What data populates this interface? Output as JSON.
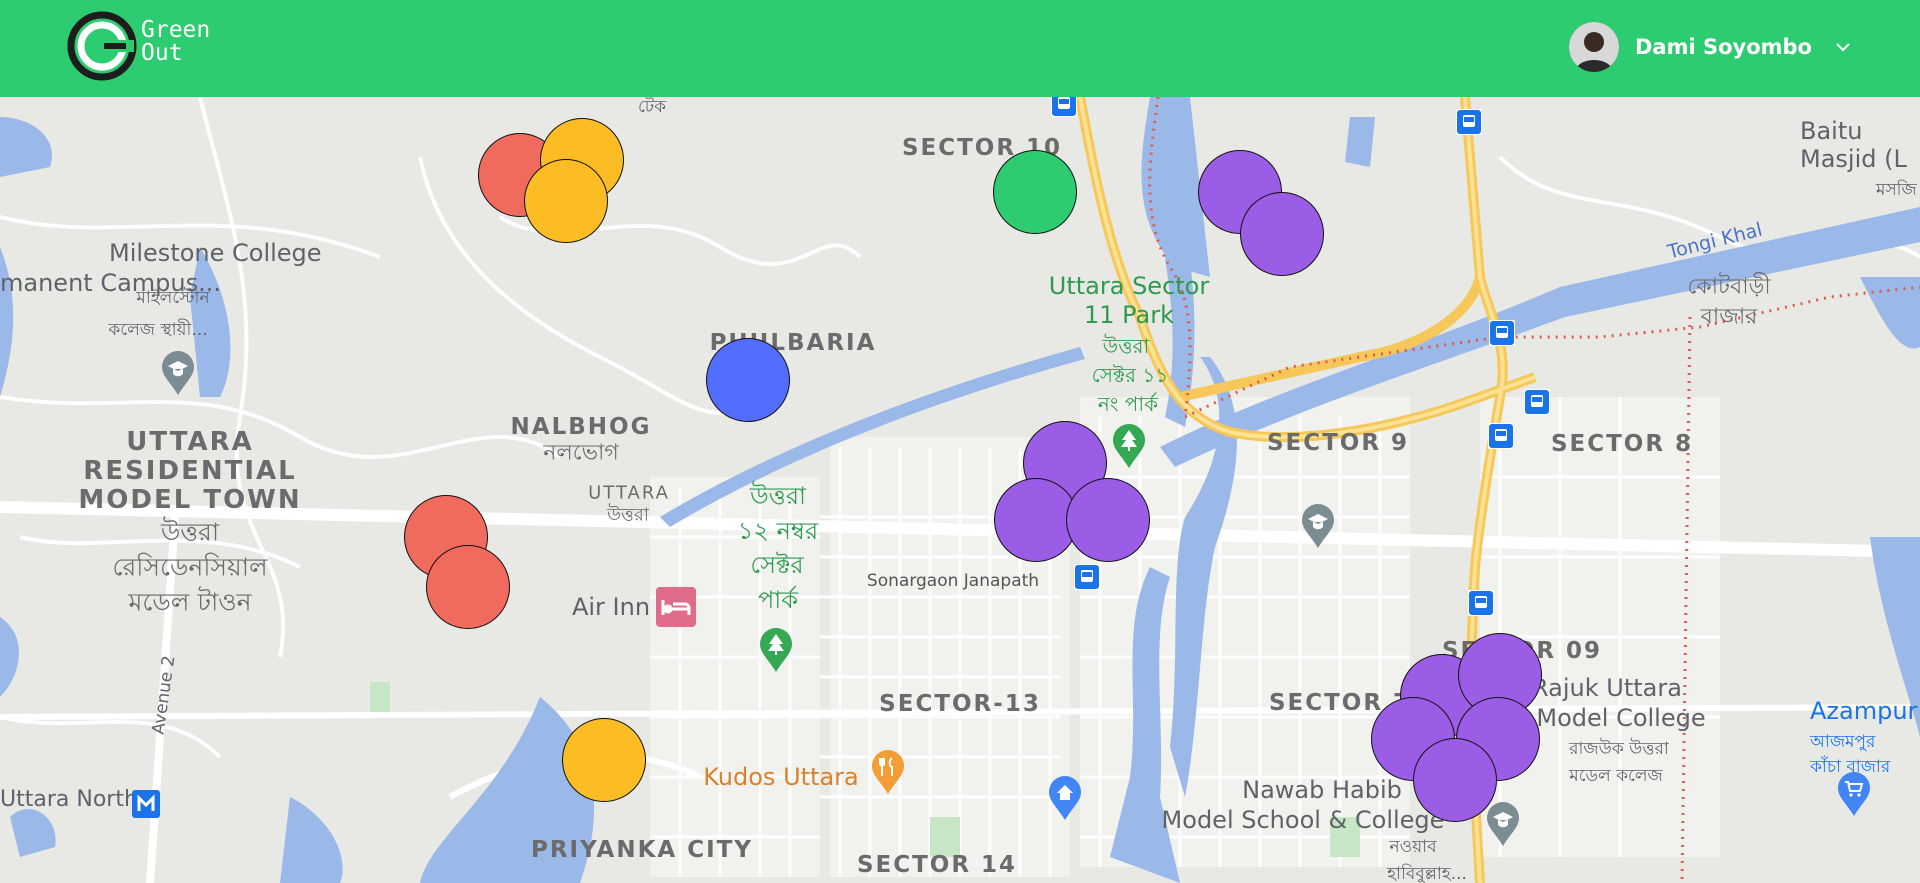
{
  "header": {
    "logo_line1": "Green",
    "logo_line2": "Out",
    "user_name": "Dami Soyombo"
  },
  "colors": {
    "brand": "#2ecc71",
    "red": "#f06b5e",
    "yellow": "#fbbd23",
    "green": "#2ecc71",
    "purple": "#9b5de5",
    "blue": "#536dfe"
  },
  "map_labels": {
    "tek": "টেক",
    "sector10": "SECTOR 10",
    "milestone1": "Milestone College",
    "milestone2": "manent Campus...",
    "milestone_bn1": "মাইলস্টোন",
    "milestone_bn2": "কলেজ স্থায়ী...",
    "park11_1": "Uttara Sector",
    "park11_2": "11 Park",
    "park11_bn1": "উত্তরা",
    "park11_bn2": "সেক্টর ১১",
    "park11_bn3": "নং পার্ক",
    "phulbaria": "PHULBARIA",
    "nalbhog": "NALBHOG",
    "nalbhog_bn": "নলভোগ",
    "uttara_small": "UTTARA",
    "uttara_small_bn": "উত্তরা",
    "urmt1": "UTTARA",
    "urmt2": "RESIDENTIAL",
    "urmt3": "MODEL TOWN",
    "urmt_bn1": "উত্তরা",
    "urmt_bn2": "রেসিডেনসিয়াল",
    "urmt_bn3": "মডেল টাওন",
    "park12_1": "উত্তরা",
    "park12_2": "১২ নম্বর",
    "park12_3": "সেক্টর",
    "park12_4": "পার্ক",
    "sonargaon": "Sonargaon Janapath",
    "air_inn": "Air Inn",
    "sector9": "SECTOR 9",
    "sector8": "SECTOR 8",
    "sector09": "SECTOR 09",
    "sector13": "SECTOR-13",
    "sector7": "SECTOR 7",
    "sector14": "SECTOR 14",
    "priyanka": "PRIYANKA CITY",
    "kudos": "Kudos Uttara",
    "nawab1": "Nawab Habib",
    "nawab2": "Model School & College",
    "nawab_bn1": "নওয়াব",
    "nawab_bn2": "হাবিবুল্লাহ...",
    "rajuk1": "Rajuk Uttara",
    "rajuk2": "Model College",
    "rajuk_bn1": "রাজউক উত্তরা",
    "rajuk_bn2": "মডেল কলেজ",
    "kotbari1": "কোটবাড়ী",
    "kotbari2": "বাজার",
    "baitul1": "Baitu",
    "baitul2": "Masjid (L",
    "masjid_bn": "মসজি",
    "tongi": "Tongi Khal",
    "azampur": "Azampur",
    "azampur_bn1": "আজমপুর",
    "azampur_bn2": "কাঁচা বাজার",
    "uttara_north": "Uttara North",
    "avenue2": "Avenue 2"
  },
  "markers": [
    {
      "color": "red"
    },
    {
      "color": "yellow"
    },
    {
      "color": "yellow"
    },
    {
      "color": "green"
    },
    {
      "color": "purple"
    },
    {
      "color": "purple"
    },
    {
      "color": "blue"
    },
    {
      "color": "purple"
    },
    {
      "color": "purple"
    },
    {
      "color": "purple"
    },
    {
      "color": "red"
    },
    {
      "color": "red"
    },
    {
      "color": "yellow"
    },
    {
      "color": "purple"
    },
    {
      "color": "purple"
    },
    {
      "color": "purple"
    },
    {
      "color": "purple"
    },
    {
      "color": "purple"
    }
  ]
}
